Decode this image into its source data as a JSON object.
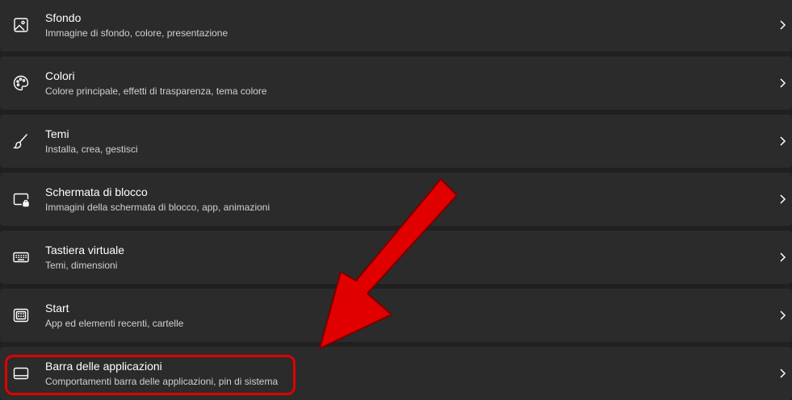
{
  "settings": {
    "items": [
      {
        "title": "Sfondo",
        "subtitle": "Immagine di sfondo, colore, presentazione",
        "icon": "image-icon"
      },
      {
        "title": "Colori",
        "subtitle": "Colore principale, effetti di trasparenza, tema colore",
        "icon": "palette-icon"
      },
      {
        "title": "Temi",
        "subtitle": "Installa, crea, gestisci",
        "icon": "brush-icon"
      },
      {
        "title": "Schermata di blocco",
        "subtitle": "Immagini della schermata di blocco, app, animazioni",
        "icon": "lock-screen-icon"
      },
      {
        "title": "Tastiera virtuale",
        "subtitle": "Temi, dimensioni",
        "icon": "keyboard-icon"
      },
      {
        "title": "Start",
        "subtitle": "App ed elementi recenti, cartelle",
        "icon": "start-icon"
      },
      {
        "title": "Barra delle applicazioni",
        "subtitle": "Comportamenti barra delle applicazioni, pin di sistema",
        "icon": "taskbar-icon"
      }
    ]
  },
  "colors": {
    "background": "#202020",
    "row": "#2b2b2b",
    "text": "#ffffff",
    "subtext": "#d0d0d0",
    "annotation": "#e00000"
  }
}
